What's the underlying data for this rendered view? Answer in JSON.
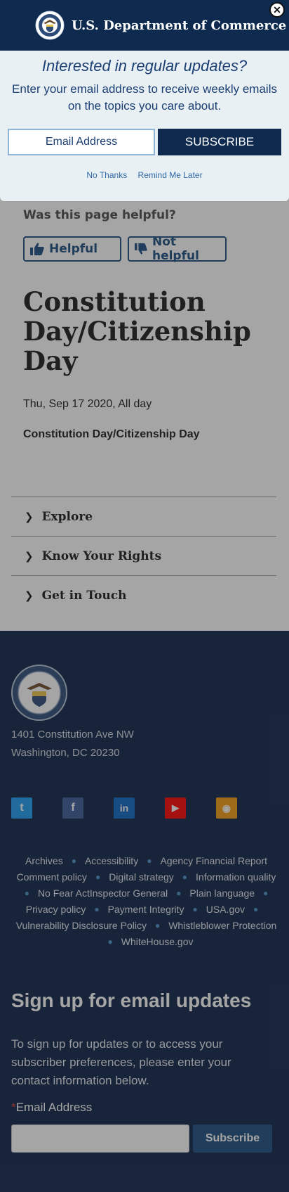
{
  "popup": {
    "agency_name": "U.S. Department of Commerce",
    "close_glyph": "✕",
    "question": "Interested in regular updates?",
    "subtext": "Enter your email address to receive weekly emails on the topics you care about.",
    "email_placeholder": "Email Address",
    "subscribe_label": "SUBSCRIBE",
    "no_thanks": "No Thanks",
    "remind_later": "Remind Me Later"
  },
  "feedback": {
    "question": "Was this page helpful?",
    "helpful_label": "Helpful",
    "not_helpful_label": "Not helpful"
  },
  "event": {
    "title": "Constitution Day/Citizenship Day",
    "date": "Thu, Sep 17 2020, All day",
    "description": "Constitution Day/Citizenship Day"
  },
  "accordion": {
    "items": [
      {
        "label": "Explore"
      },
      {
        "label": "Know Your Rights"
      },
      {
        "label": "Get in Touch"
      }
    ]
  },
  "footer": {
    "address_line1": "1401 Constitution Ave NW",
    "address_line2": "Washington, DC 20230",
    "social": [
      {
        "icon": "twitter-icon",
        "glyph": "t",
        "color": "#1d9bf0"
      },
      {
        "icon": "facebook-icon",
        "glyph": "f",
        "color": "#3b5998"
      },
      {
        "icon": "linkedin-icon",
        "glyph": "in",
        "color": "#0a66c2"
      },
      {
        "icon": "youtube-icon",
        "glyph": "▶",
        "color": "#ff0000"
      },
      {
        "icon": "rss-icon",
        "glyph": "◉",
        "color": "#f39c12"
      }
    ],
    "links": [
      "Archives",
      "Accessibility",
      "Agency Financial Report",
      "Comment policy",
      "Digital strategy",
      "Information quality",
      "No Fear Act",
      "Inspector General",
      "Plain language",
      "Privacy policy",
      "Payment Integrity",
      "USA.gov",
      "Vulnerability Disclosure Policy",
      "Whistleblower Protection",
      "WhiteHouse.gov"
    ],
    "signup_heading": "Sign up for email updates",
    "signup_text": "To sign up for updates or to access your subscriber preferences, please enter your contact information below.",
    "signup_required_mark": "*",
    "signup_label": "Email Address",
    "signup_button": "Subscribe"
  },
  "colors": {
    "navy": "#0f2a4f",
    "footer_bg": "#0d2248",
    "link_blue": "#1b4e80"
  }
}
